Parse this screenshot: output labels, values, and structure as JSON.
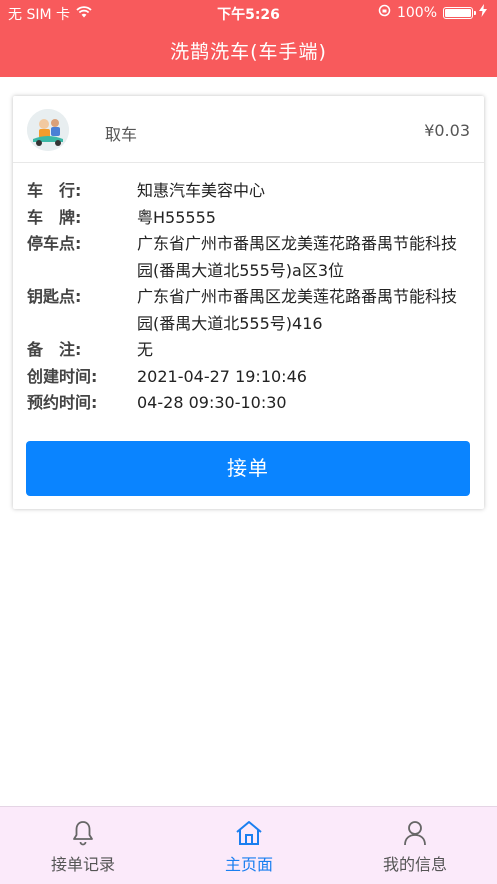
{
  "status": {
    "carrier": "无 SIM 卡",
    "time": "下午5:26",
    "battery": "100%",
    "battery_level": 1.0
  },
  "header": {
    "title": "洗鹊洗车(车手端)"
  },
  "order": {
    "service": "取车",
    "price": "¥0.03",
    "fields": [
      {
        "label": "车　行:",
        "value": "知惠汽车美容中心"
      },
      {
        "label": "车　牌:",
        "value": "粤H55555"
      },
      {
        "label": "停车点:",
        "value": "广东省广州市番禺区龙美莲花路番禺节能科技园(番禺大道北555号)a区3位"
      },
      {
        "label": "钥匙点:",
        "value": "广东省广州市番禺区龙美莲花路番禺节能科技园(番禺大道北555号)416"
      },
      {
        "label": "备　注:",
        "value": "无"
      },
      {
        "label": "创建时间:",
        "value": "2021-04-27 19:10:46"
      },
      {
        "label": "预约时间:",
        "value": "04-28 09:30-10:30"
      }
    ],
    "accept_label": "接单"
  },
  "tabs": [
    {
      "label": "接单记录",
      "icon": "bell-icon"
    },
    {
      "label": "主页面",
      "icon": "home-icon",
      "active": true
    },
    {
      "label": "我的信息",
      "icon": "person-icon"
    }
  ],
  "colors": {
    "header": "#f85a5c",
    "accent": "#0a84ff",
    "tabbar": "#fbeafa"
  }
}
